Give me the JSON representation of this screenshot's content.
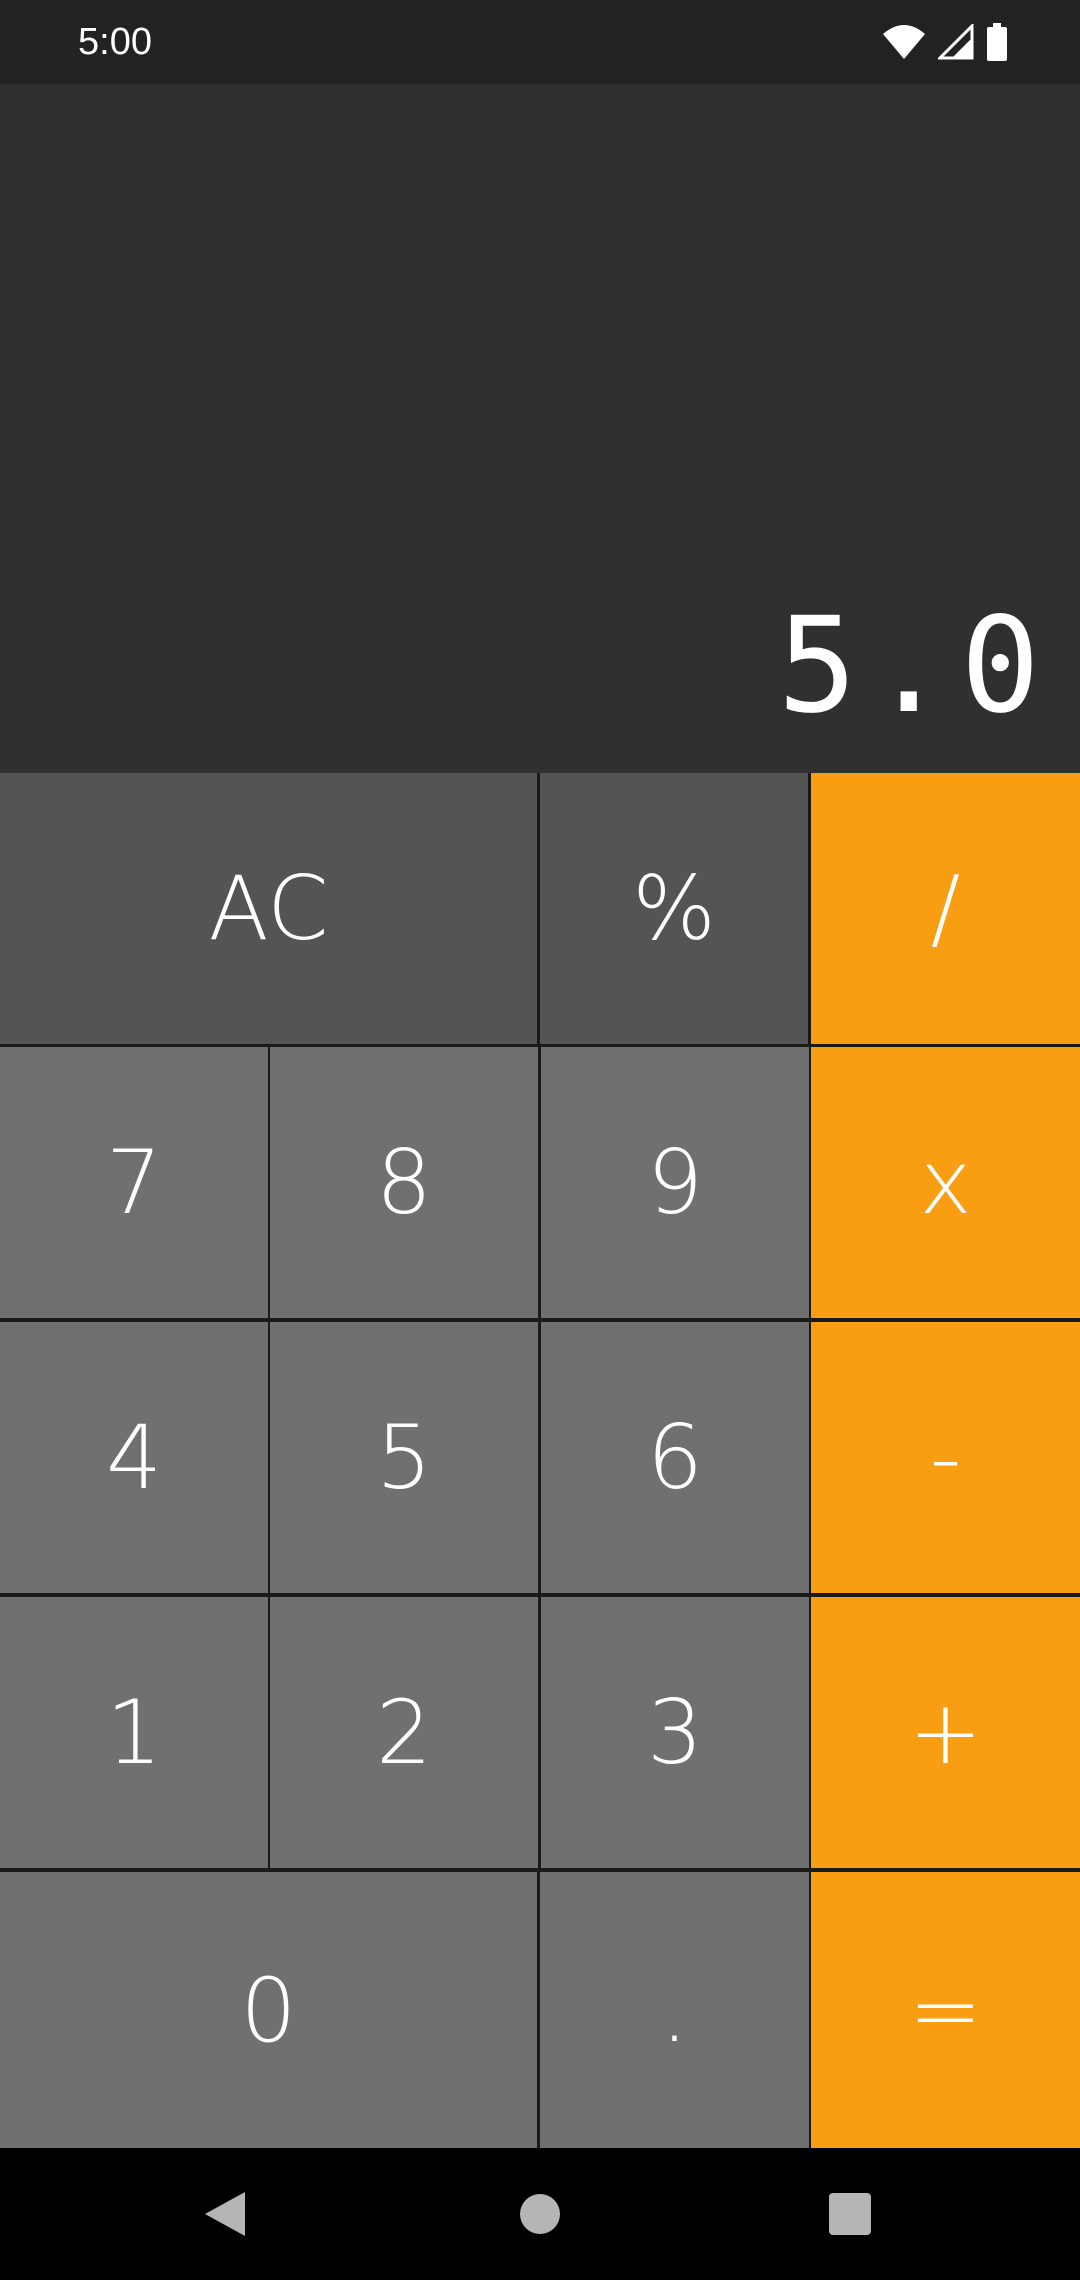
{
  "status_bar": {
    "time": "5:00",
    "icons": [
      "wifi-icon",
      "cell-signal-icon",
      "battery-icon"
    ]
  },
  "display": {
    "value": "5.0"
  },
  "keys": {
    "clear": "AC",
    "percent": "%",
    "divide": "/",
    "seven": "7",
    "eight": "8",
    "nine": "9",
    "multiply": "x",
    "four": "4",
    "five": "5",
    "six": "6",
    "subtract": "-",
    "one": "1",
    "two": "2",
    "three": "3",
    "add": "+",
    "zero": "0",
    "decimal": ".",
    "equals": "="
  },
  "nav_bar": {
    "icons": [
      "back-icon",
      "home-icon",
      "recents-icon"
    ]
  },
  "colors": {
    "operator": "#f99e12",
    "function_key": "#545454",
    "number_key": "#707070",
    "display_bg": "#303030",
    "status_bar_bg": "#222222"
  }
}
